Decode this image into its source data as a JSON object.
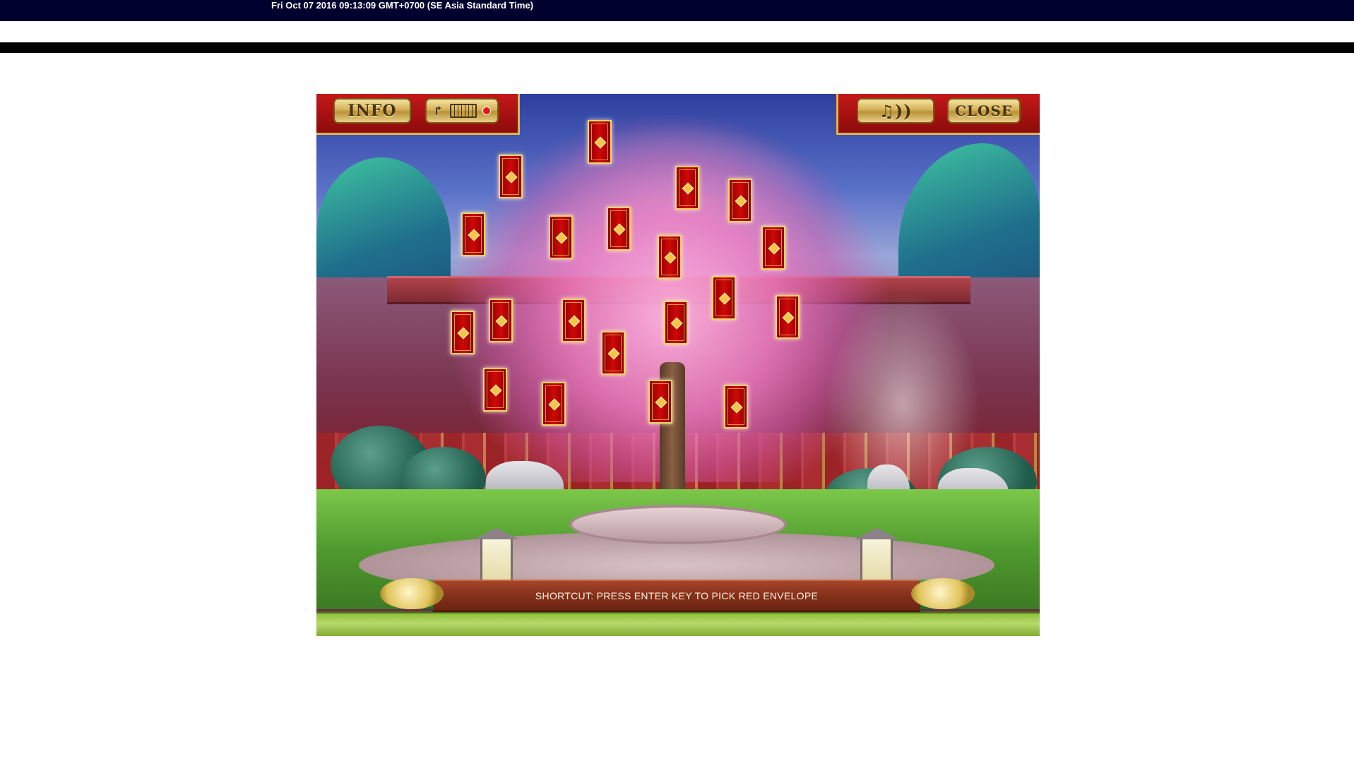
{
  "header": {
    "timestamp": "Fri Oct 07 2016 09:13:09 GMT+0700 (SE Asia Standard Time)"
  },
  "game": {
    "toolbar_left": {
      "info_label": "INFO",
      "keyboard_icon": "keyboard-shortcut-icon"
    },
    "toolbar_right": {
      "sound_icon": "music-sound-icon",
      "sound_label": "♫))",
      "close_label": "CLOSE"
    },
    "envelope_count": 20,
    "shortcut_text": "SHORTCUT: PRESS ENTER KEY TO PICK RED ENVELOPE"
  },
  "colors": {
    "topbar": "#00002e",
    "panel_red": "#c41818",
    "gold": "#d4b25a",
    "envelope_red": "#d00808"
  }
}
